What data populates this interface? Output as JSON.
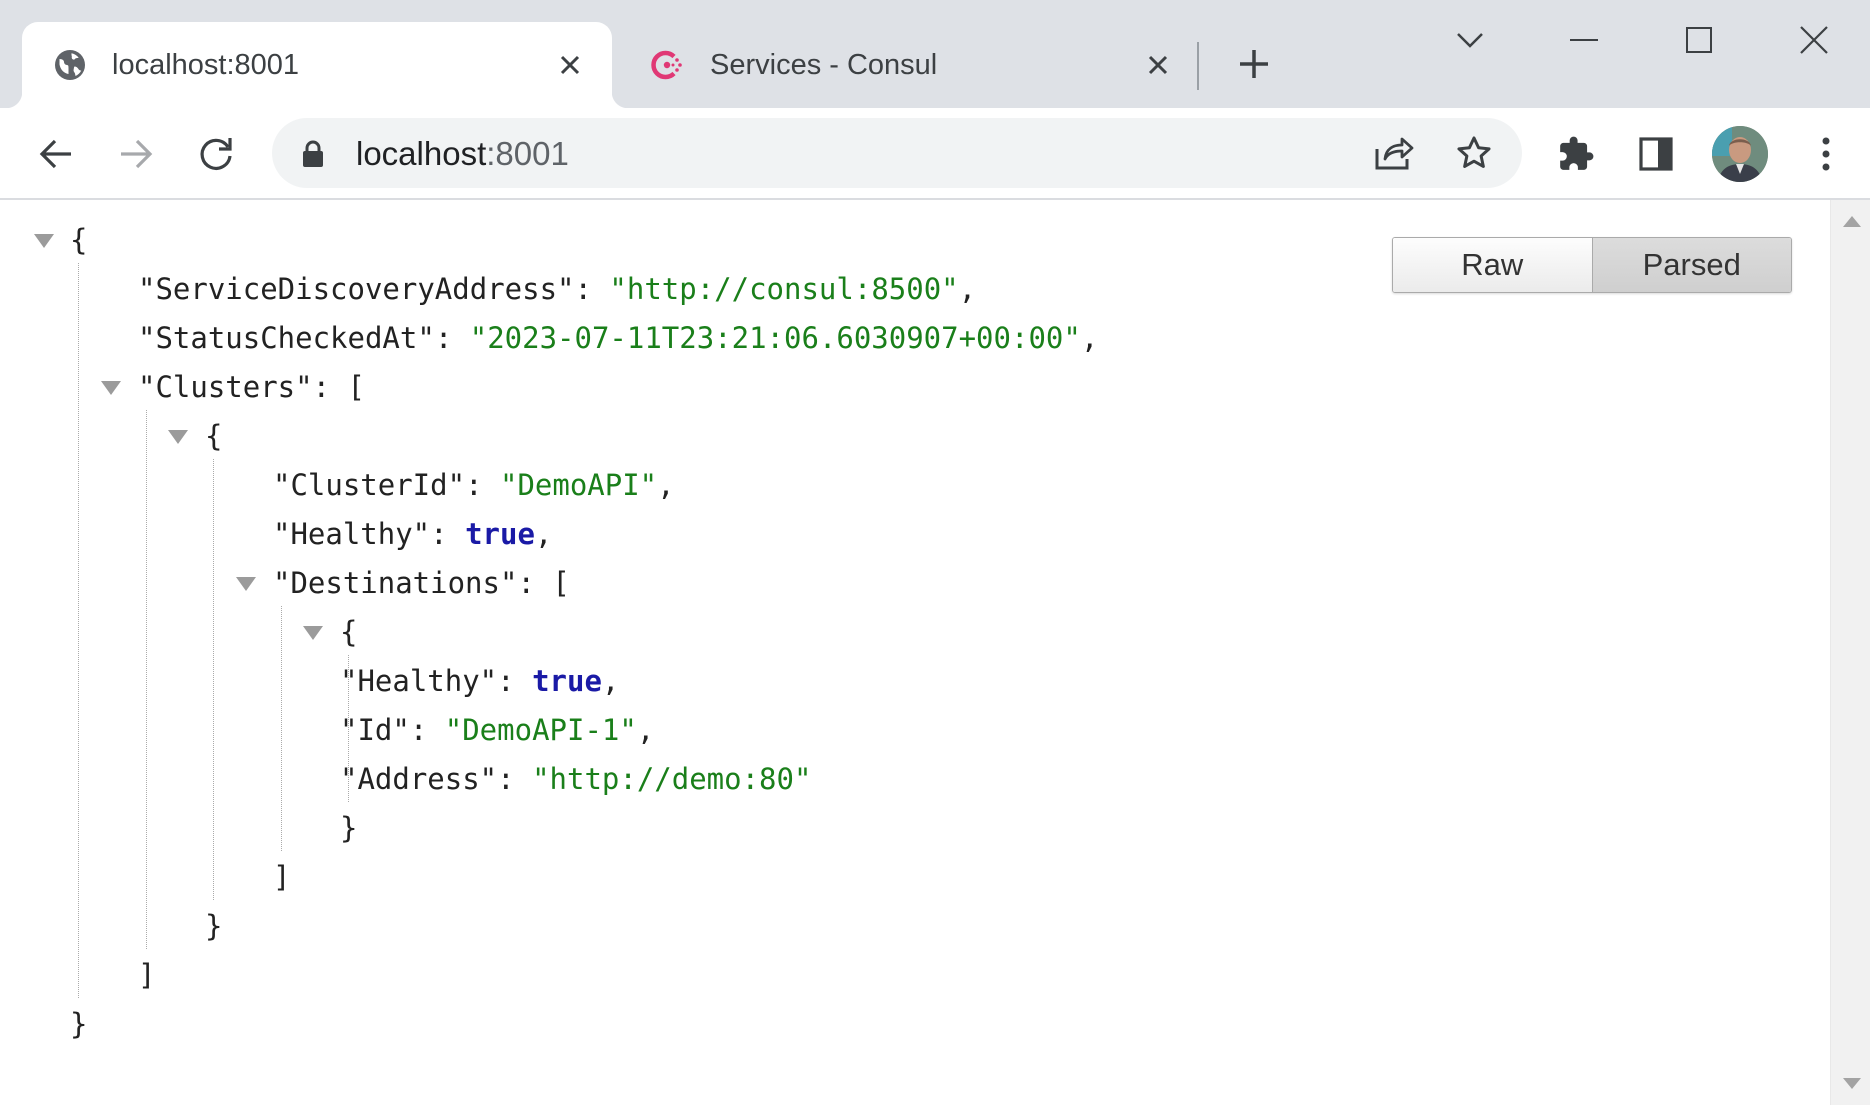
{
  "tabs": [
    {
      "title": "localhost:8001",
      "active": true
    },
    {
      "title": "Services - Consul",
      "active": false
    }
  ],
  "address_bar": {
    "host": "localhost",
    "port": ":8001"
  },
  "viewer": {
    "raw_label": "Raw",
    "parsed_label": "Parsed",
    "selected": "Parsed"
  },
  "json_lines": [
    {
      "text": "{"
    },
    {
      "key": "\"ServiceDiscoveryAddress\"",
      "value": "\"http://consul:8500\"",
      "type": "string",
      "suffix": ","
    },
    {
      "key": "\"StatusCheckedAt\"",
      "value": "\"2023-07-11T23:21:06.6030907+00:00\"",
      "type": "string",
      "suffix": ","
    },
    {
      "key": "\"Clusters\"",
      "open": "["
    },
    {
      "text": "{"
    },
    {
      "key": "\"ClusterId\"",
      "value": "\"DemoAPI\"",
      "type": "string",
      "suffix": ","
    },
    {
      "key": "\"Healthy\"",
      "value": "true",
      "type": "bool",
      "suffix": ","
    },
    {
      "key": "\"Destinations\"",
      "open": "["
    },
    {
      "text": "{"
    },
    {
      "key": "\"Healthy\"",
      "value": "true",
      "type": "bool",
      "suffix": ","
    },
    {
      "key": "\"Id\"",
      "value": "\"DemoAPI-1\"",
      "type": "string",
      "suffix": ","
    },
    {
      "key": "\"Address\"",
      "value": "\"http://demo:80\"",
      "type": "string",
      "suffix": ""
    },
    {
      "text": "}"
    },
    {
      "text": "]"
    },
    {
      "text": "}"
    },
    {
      "text": "]"
    },
    {
      "text": "}"
    }
  ],
  "colors": {
    "string": "#1a7f1a",
    "boolean": "#1a1aa6",
    "tab_strip": "#dee1e6",
    "consul_brand": "#e03875"
  }
}
